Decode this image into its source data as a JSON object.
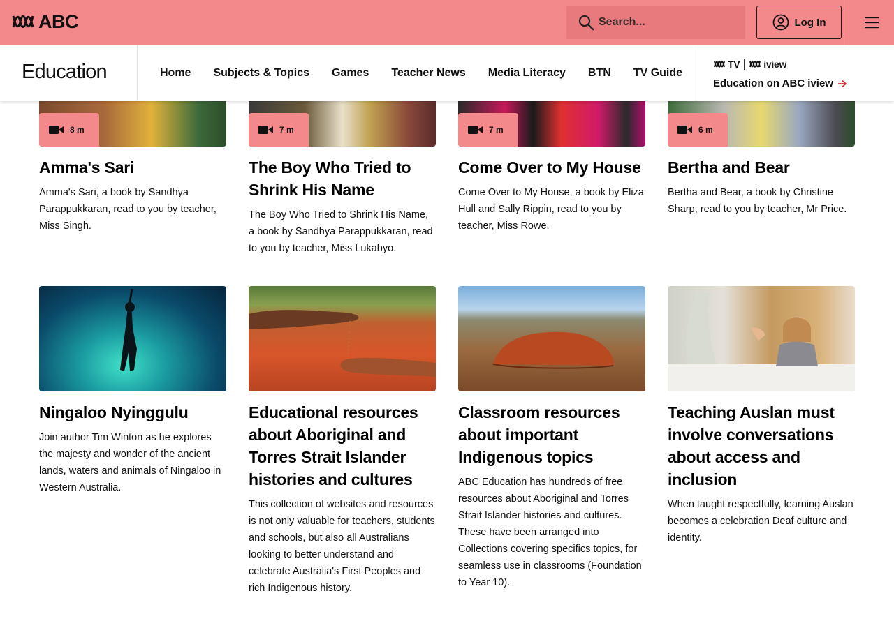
{
  "header": {
    "logo_text": "ABC",
    "search_placeholder": "Search...",
    "login_label": "Log In",
    "brand_color": "#f4898b"
  },
  "section_nav": {
    "title": "Education",
    "links": [
      "Home",
      "Subjects & Topics",
      "Games",
      "Teacher News",
      "Media Literacy",
      "BTN",
      "TV Guide"
    ],
    "logo_tv": "TV",
    "logo_iview": "iview",
    "iview_link": "Education on ABC iview"
  },
  "cards_row1": [
    {
      "title": "Amma's Sari",
      "duration": "8 m",
      "description": "Amma's Sari, a book by Sandhya Parappukkaran, read to you by teacher, Miss Singh."
    },
    {
      "title": "The Boy Who Tried to Shrink His Name",
      "duration": "7 m",
      "description": "The Boy Who Tried to Shrink His Name, a book by Sandhya Parappukkaran, read to you by teacher, Miss Lukabyo."
    },
    {
      "title": "Come Over to My House",
      "duration": "7 m",
      "description": "Come Over to My House, a book by Eliza Hull and Sally Rippin, read to you by teacher, Miss Rowe."
    },
    {
      "title": "Bertha and Bear",
      "duration": "6 m",
      "description": "Bertha and Bear, a book by Christine Sharp, read to you by teacher, Mr Price."
    }
  ],
  "cards_row2": [
    {
      "title": "Ningaloo Nyinggulu",
      "description": "Join author Tim Winton as he explores the majesty and wonder of the ancient lands, waters and animals of Ningaloo in Western Australia."
    },
    {
      "title": "Educational resources about Aboriginal and Torres Strait Islander histories and cultures",
      "description": "This collection of websites and resources is not only valuable for teachers, students and schools, but also all Australians looking to better understand and celebrate Australia's First Peoples and rich Indigenous history."
    },
    {
      "title": "Classroom resources about important Indigenous topics",
      "description": "ABC Education has hundreds of free resources about Aboriginal and Torres Strait Islander histories and cultures. These have been arranged into Collections covering specifics topics, for seamless use in classrooms (Foundation to Year 10)."
    },
    {
      "title": "Teaching Auslan must involve conversations about access and inclusion",
      "description": "When taught respectfully, learning Auslan becomes a celebration Deaf culture and identity."
    }
  ]
}
